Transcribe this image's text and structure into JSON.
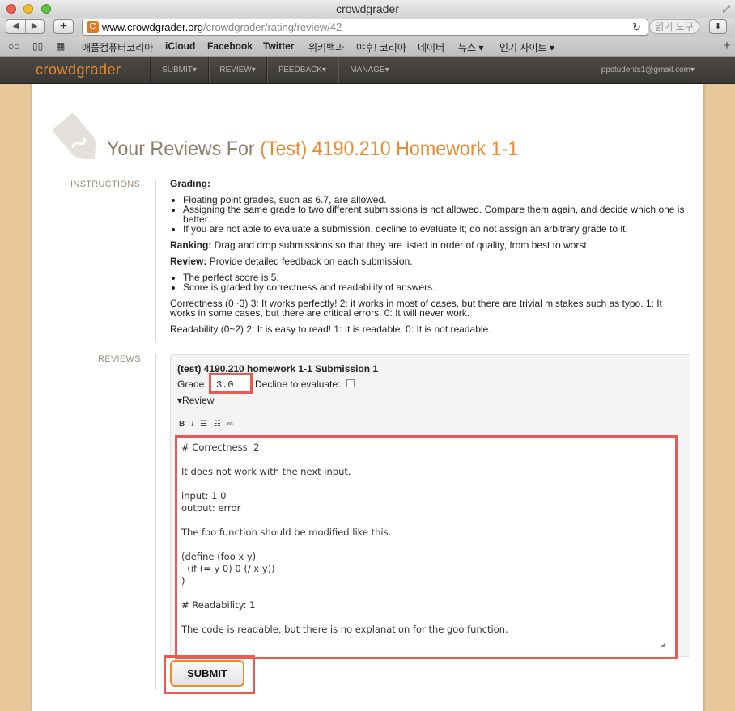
{
  "window": {
    "title": "crowdgrader"
  },
  "browser": {
    "url_host": "www.crowdgrader.org",
    "url_path": "/crowdgrader/rating/review/42",
    "reader_label": "읽기 도구",
    "bookmarks": [
      "애플컴퓨터코리아",
      "iCloud",
      "Facebook",
      "Twitter",
      "위키백과",
      "야후! 코리아",
      "네이버",
      "뉴스 ▾",
      "인기 사이트 ▾"
    ]
  },
  "app": {
    "logo": "crowdgrader",
    "nav": [
      "SUBMIT▾",
      "REVIEW▾",
      "FEEDBACK▾",
      "MANAGE▾"
    ],
    "user": "ppstudents1@gmail.com▾"
  },
  "page": {
    "heading_prefix": "Your Reviews For ",
    "heading_course": "(Test) 4190.210 Homework 1-1"
  },
  "instructions": {
    "label": "INSTRUCTIONS",
    "grading_title": "Grading:",
    "grading_items": [
      "Floating point grades, such as 6.7, are allowed.",
      "Assigning the same grade to two different submissions is not allowed. Compare them again, and decide which one is better.",
      "If you are not able to evaluate a submission, decline to evaluate it; do not assign an arbitrary grade to it."
    ],
    "ranking_title": "Ranking:",
    "ranking_text": " Drag and drop submissions so that they are listed in order of quality, from best to worst.",
    "review_title": "Review:",
    "review_text": " Provide detailed feedback on each submission.",
    "review_items": [
      "The perfect score is 5.",
      "Score is graded by correctness and readability of answers."
    ],
    "correctness_text": "Correctness (0~3) 3: It works perfectly! 2: it works in most of cases, but there are trivial mistakes such as typo. 1: It works in some cases, but there are critical errors. 0: It will never work.",
    "readability_text": "Readability (0~2) 2: It is easy to read! 1: It is readable. 0: It is not readable."
  },
  "reviews": {
    "label": "REVIEWS",
    "submission_title": "(test) 4190.210 homework 1-1 Submission 1",
    "grade_label": "Grade:",
    "grade_value": "3.0",
    "decline_label": "Decline to evaluate:",
    "decline_checked": false,
    "review_toggle": "▾Review",
    "review_text": "# Correctness: 2\n\nIt does not work with the next input.\n\ninput: 1 0\noutput: error\n\nThe foo function should be modified like this.\n\n(define (foo x y)\n  (if (= y 0) 0 (/ x y))\n)\n\n# Readability: 1\n\nThe code is readable, but there is no explanation for the goo function.",
    "submit_label": "SUBMIT"
  },
  "colors": {
    "accent": "#e98a2f",
    "highlight": "#ea5a55",
    "nav_bg": "#443f3b"
  }
}
